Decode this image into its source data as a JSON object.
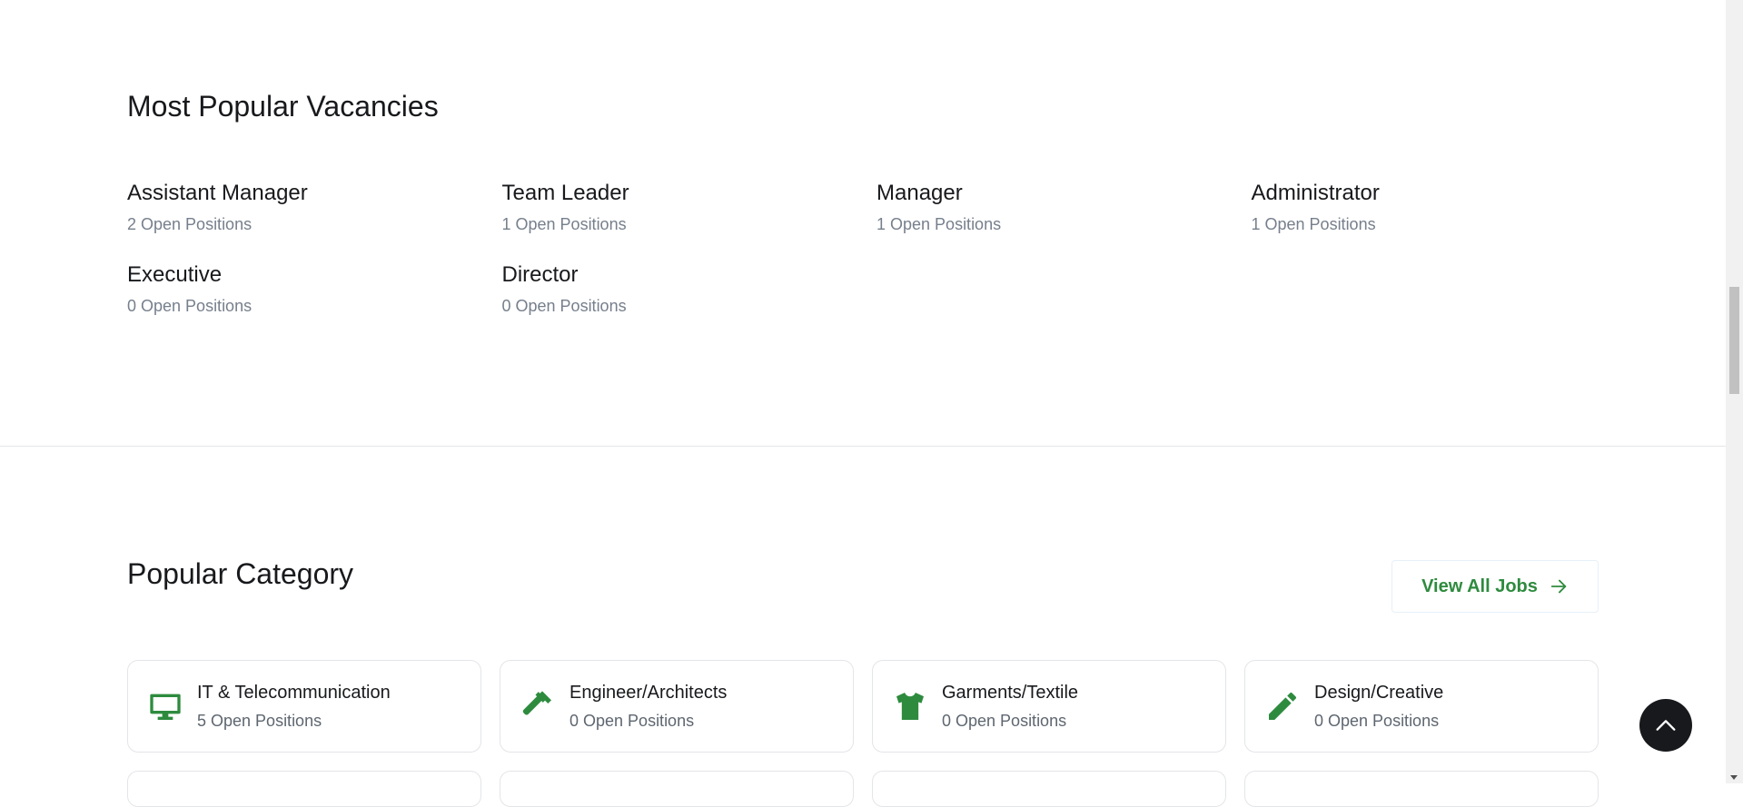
{
  "vacancies": {
    "title": "Most Popular Vacancies",
    "items": [
      {
        "name": "Assistant Manager",
        "count": "2 Open Positions"
      },
      {
        "name": "Team Leader",
        "count": "1 Open Positions"
      },
      {
        "name": "Manager",
        "count": "1 Open Positions"
      },
      {
        "name": "Administrator",
        "count": "1 Open Positions"
      },
      {
        "name": "Executive",
        "count": "0 Open Positions"
      },
      {
        "name": "Director",
        "count": "0 Open Positions"
      }
    ]
  },
  "categories": {
    "title": "Popular Category",
    "view_all_label": "View All Jobs",
    "items": [
      {
        "name": "IT & Telecommunication",
        "count": "5 Open Positions",
        "icon": "monitor-icon"
      },
      {
        "name": "Engineer/Architects",
        "count": "0 Open Positions",
        "icon": "hammer-icon"
      },
      {
        "name": "Garments/Textile",
        "count": "0 Open Positions",
        "icon": "tshirt-icon"
      },
      {
        "name": "Design/Creative",
        "count": "0 Open Positions",
        "icon": "pencil-icon"
      }
    ]
  },
  "colors": {
    "accent": "#2e8b3e",
    "text": "#18191c",
    "muted": "#767f8c"
  }
}
